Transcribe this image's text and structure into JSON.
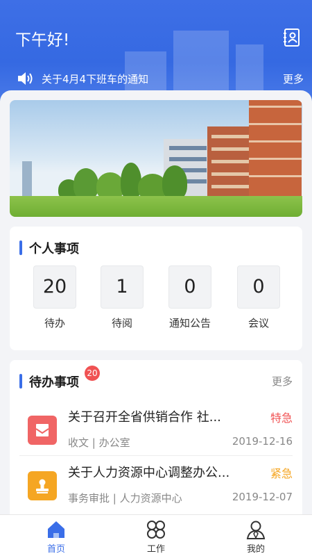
{
  "header": {
    "greeting": "下午好!",
    "notice": "关于4月4下班车的通知",
    "notice_more": "更多",
    "contacts_icon": "contacts-book-icon",
    "speaker_icon": "speaker-icon"
  },
  "personal": {
    "title": "个人事项",
    "stats": [
      {
        "value": "20",
        "label": "待办"
      },
      {
        "value": "1",
        "label": "待阅"
      },
      {
        "value": "0",
        "label": "通知公告"
      },
      {
        "value": "0",
        "label": "会议"
      }
    ]
  },
  "todo": {
    "title": "待办事项",
    "badge": "20",
    "more": "更多",
    "items": [
      {
        "title": "关于召开全省供销合作 社...",
        "tag": "特急",
        "tag_color": "#f05253",
        "meta": "收文 | 办公室",
        "date": "2019-12-16",
        "icon": "mail-icon",
        "icon_color": "#f06565"
      },
      {
        "title": "关于人力资源中心调整办公...",
        "tag": "紧急",
        "tag_color": "#f5a623",
        "meta": "事务审批 | 人力资源中心",
        "date": "2019-12-07",
        "icon": "stamp-icon",
        "icon_color": "#f5a623"
      }
    ]
  },
  "tabbar": {
    "tabs": [
      {
        "label": "首页",
        "icon": "home-icon",
        "active": true
      },
      {
        "label": "工作",
        "icon": "grid-clover-icon",
        "active": false
      },
      {
        "label": "我的",
        "icon": "user-icon",
        "active": false
      }
    ]
  },
  "colors": {
    "primary": "#3a6ee8",
    "urgent_red": "#f05253",
    "urgent_orange": "#f5a623"
  }
}
